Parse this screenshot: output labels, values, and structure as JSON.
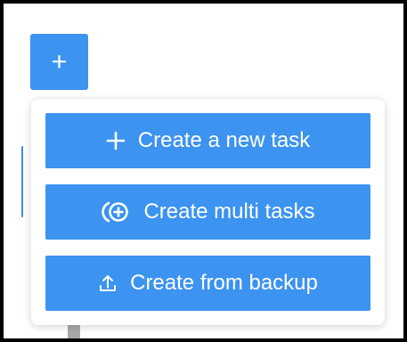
{
  "trigger": {
    "label": "+",
    "icon": "plus-icon"
  },
  "menu": {
    "items": [
      {
        "label": "Create a new task",
        "icon": "plus-icon"
      },
      {
        "label": "Create multi tasks",
        "icon": "multi-add-icon"
      },
      {
        "label": "Create from backup",
        "icon": "upload-icon"
      }
    ]
  },
  "colors": {
    "accent": "#3c93f0",
    "text_on_accent": "#ffffff",
    "frame": "#000000"
  }
}
